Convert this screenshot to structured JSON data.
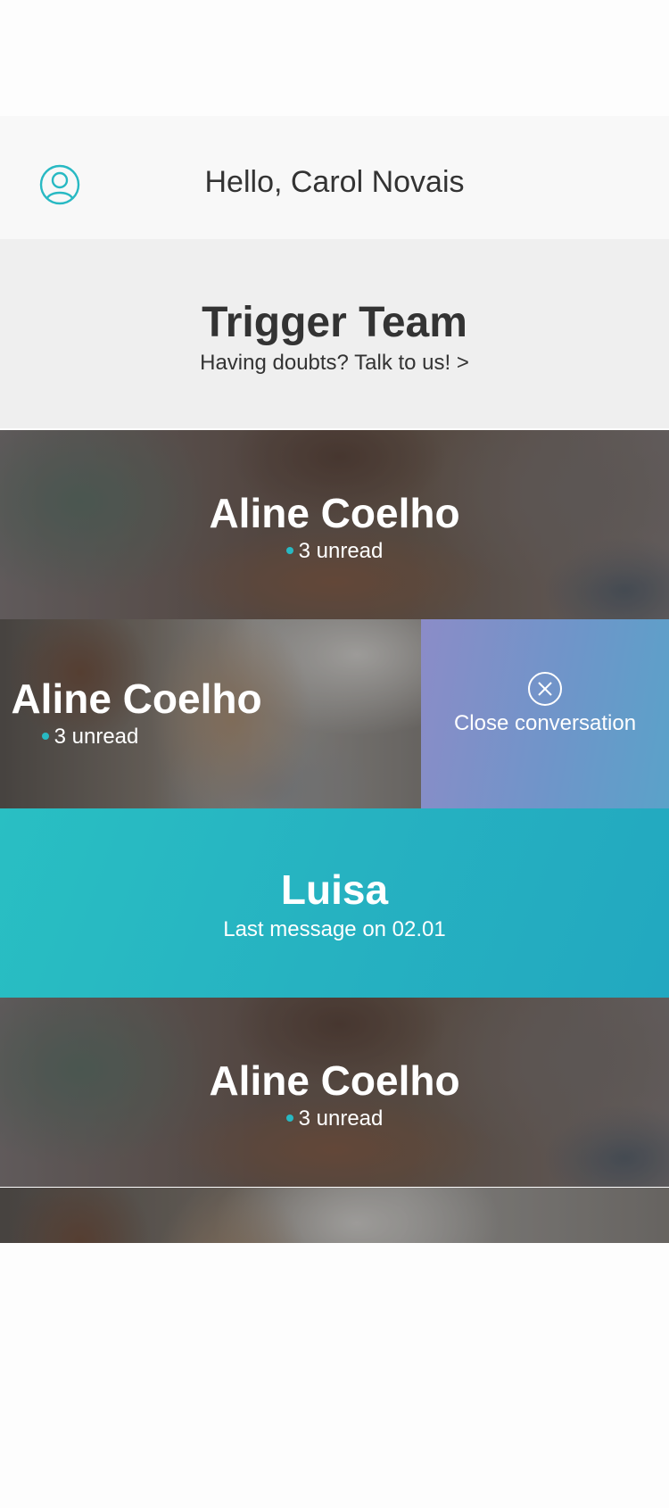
{
  "header": {
    "greeting": "Hello, Carol Novais",
    "profile_icon": "user-circle-icon"
  },
  "trigger_team": {
    "title": "Trigger Team",
    "subtitle": "Having doubts? Talk to us! >"
  },
  "conversations": [
    {
      "name": "Aline Coelho",
      "status": "3 unread",
      "photo": "woman-in-scarf"
    },
    {
      "name": "Aline Coelho",
      "status": "3 unread",
      "photo": "woman-blowing-bubbles",
      "swiped": true
    },
    {
      "name": "Luisa",
      "status": "Last message on 02.01",
      "active": true
    },
    {
      "name": "Aline Coelho",
      "status": "3 unread",
      "photo": "woman-in-scarf"
    }
  ],
  "swipe_action": {
    "label": "Close conversation",
    "icon": "close-circle-icon"
  },
  "colors": {
    "accent": "#28b9c3",
    "active_row": "#25b3c1",
    "swipe_action": "#7895c9",
    "header_bg": "#f8f8f8",
    "banner_bg": "#efefef",
    "text_dark": "#333333"
  }
}
